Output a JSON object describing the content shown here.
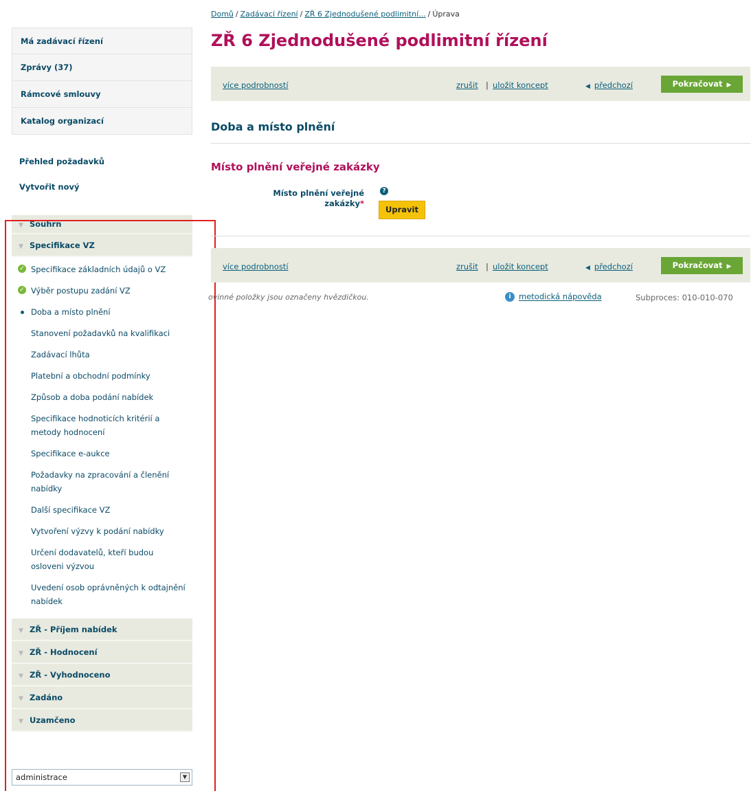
{
  "breadcrumb": {
    "items": [
      "Domů",
      "Zadávací řízení",
      "ZŘ 6 Zjednodušené podlimitní...",
      "Úprava"
    ],
    "separator": "/"
  },
  "topnav": [
    "Má zadávací řízení",
    "Zprávy (37)",
    "Rámcové smlouvy",
    "Katalog organizací"
  ],
  "sidelinks": [
    "Přehled požadavků",
    "Vytvořit nový"
  ],
  "process": {
    "phase_first": "Souhrn",
    "phase_active": "Specifikace VZ",
    "steps": [
      {
        "label": "Specifikace základních údajů o VZ",
        "state": "done"
      },
      {
        "label": "Výběr postupu zadání VZ",
        "state": "done"
      },
      {
        "label": "Doba a místo plnění",
        "state": "current"
      },
      {
        "label": "Stanovení požadavků na kvalifikaci",
        "state": "todo"
      },
      {
        "label": "Zadávací lhůta",
        "state": "todo"
      },
      {
        "label": "Platební a obchodní podmínky",
        "state": "todo"
      },
      {
        "label": "Způsob a doba podání nabídek",
        "state": "todo"
      },
      {
        "label": "Specifikace hodnoticích kritérií a metody hodnocení",
        "state": "todo"
      },
      {
        "label": "Specifikace e-aukce",
        "state": "todo"
      },
      {
        "label": "Požadavky na zpracování a členění nabídky",
        "state": "todo"
      },
      {
        "label": "Další specifikace VZ",
        "state": "todo"
      },
      {
        "label": "Vytvoření výzvy k podání nabídky",
        "state": "todo"
      },
      {
        "label": "Určení dodavatelů, kteří budou osloveni výzvou",
        "state": "todo"
      },
      {
        "label": "Uvedení osob oprávněných k odtajnění nabídek",
        "state": "todo"
      }
    ],
    "phases_after": [
      "ZŘ - Příjem nabídek",
      "ZŘ - Hodnocení",
      "ZŘ - Vyhodnoceno",
      "Zadáno",
      "Uzamčeno"
    ]
  },
  "select": {
    "value": "administrace"
  },
  "page_title": "ZŘ 6 Zjednodušené podlimitní řízení",
  "actionbar": {
    "more": "více podrobností",
    "cancel": "zrušit",
    "pipe": "|",
    "draft": "uložit koncept",
    "prev": "předchozí",
    "continue": "Pokračovat"
  },
  "section_title": "Doba a místo plnění",
  "subsection_title": "Místo plnění veřejné zakázky",
  "field": {
    "label": "Místo plnění veřejné zakázky",
    "required_mark": "*",
    "help": "?",
    "edit": "Upravit"
  },
  "footer": {
    "note": "ovinné položky jsou označeny hvězdičkou.",
    "help_link": "metodická nápověda",
    "help_icon": "i",
    "subprocess": "Subproces: 010-010-070"
  },
  "colors": {
    "title": "#b0105a",
    "link": "#0a5f7a",
    "bar": "#e8eae0",
    "continue": "#6aa636",
    "edit": "#f5c20a",
    "frame": "#e02020"
  }
}
